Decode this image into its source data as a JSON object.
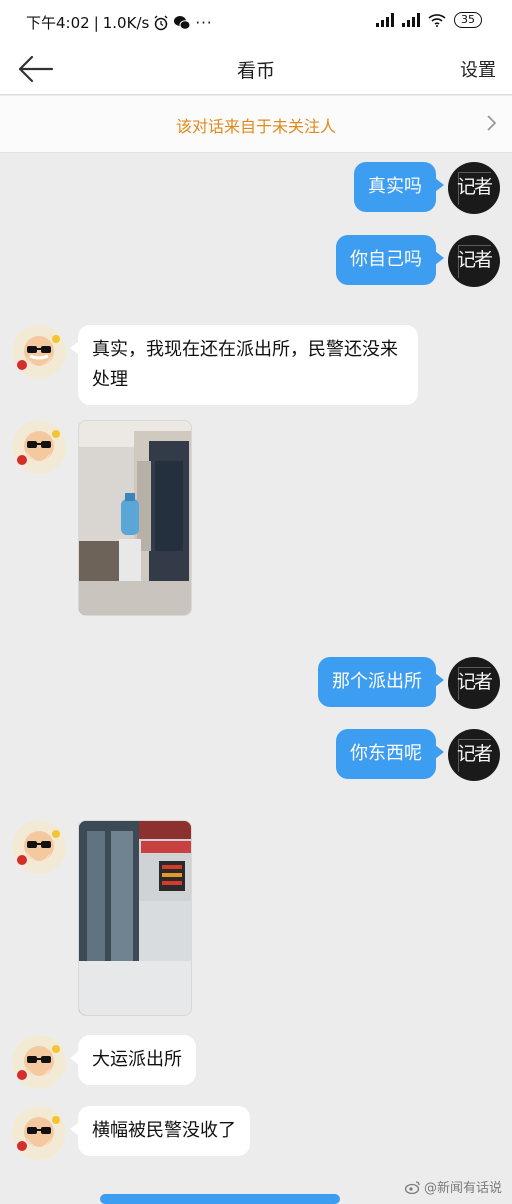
{
  "status_bar": {
    "time": "下午4:02",
    "speed": "1.0K/s",
    "battery": "35"
  },
  "header": {
    "title": "看币",
    "settings_label": "设置"
  },
  "notice": {
    "text": "该对话来自于未关注人"
  },
  "messages": [
    {
      "from": "me",
      "text": "真实吗"
    },
    {
      "from": "me",
      "text": "你自己吗"
    },
    {
      "from": "them",
      "text": "真实，我现在还在派出所，民警还没来处理"
    },
    {
      "from": "them",
      "type": "image"
    },
    {
      "from": "me",
      "text": "那个派出所"
    },
    {
      "from": "me",
      "text": "你东西呢"
    },
    {
      "from": "them",
      "type": "image"
    },
    {
      "from": "them",
      "text": "大运派出所"
    },
    {
      "from": "them",
      "text": "横幅被民警没收了"
    }
  ],
  "my_avatar_glyph": "记者",
  "watermark": "@新闻有话说",
  "colors": {
    "my_bubble": "#3d9df0",
    "their_bubble": "#ffffff",
    "notice_text": "#e08a1e",
    "chat_background": "#ececec"
  }
}
